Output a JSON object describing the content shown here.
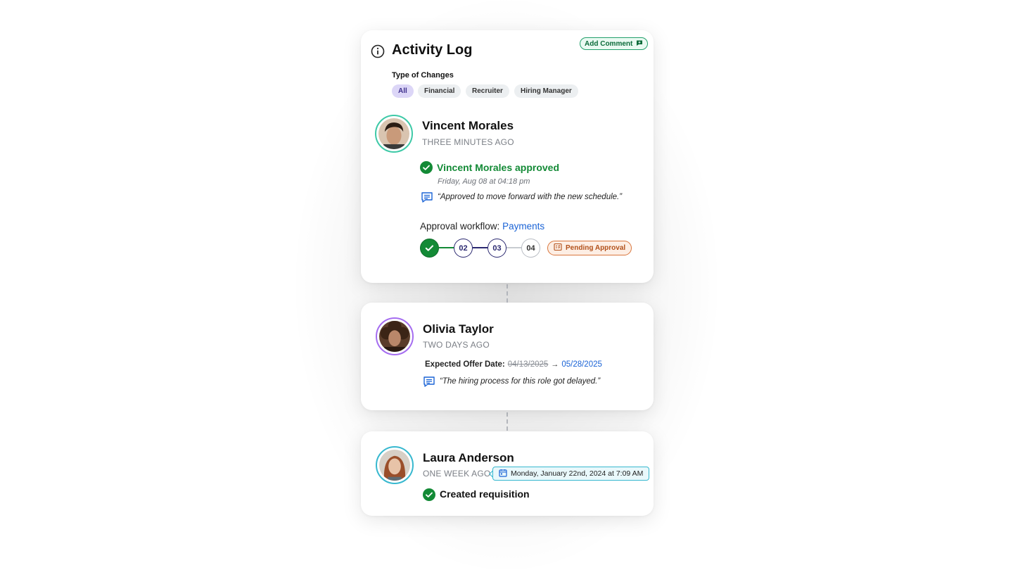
{
  "colors": {
    "accent_green": "#138a36",
    "link_blue": "#1a63d6",
    "pending_orange": "#d9763d",
    "navy": "#2a2870",
    "avatar_ring_1": "#3ec9a7",
    "avatar_ring_2": "#a56df0",
    "avatar_ring_3": "#37b8cf"
  },
  "header": {
    "title": "Activity Log",
    "add_comment_label": "Add Comment",
    "info_icon": "info-icon",
    "comment_icon": "chat-plus-icon"
  },
  "filters": {
    "title": "Type of Changes",
    "chips": [
      {
        "label": "All",
        "active": true
      },
      {
        "label": "Financial",
        "active": false
      },
      {
        "label": "Recruiter",
        "active": false
      },
      {
        "label": "Hiring Manager",
        "active": false
      }
    ]
  },
  "entries": [
    {
      "name": "Vincent Morales",
      "ago": "THREE MINUTES AGO",
      "action": "Vincent Morales approved",
      "timestamp": "Friday, Aug 08 at 04:18 pm",
      "comment": "“Approved to move forward with the new schedule.”",
      "workflow_prefix": "Approval workflow:",
      "workflow_link": "Payments",
      "steps": [
        {
          "label": "",
          "state": "done"
        },
        {
          "label": "02",
          "state": "current"
        },
        {
          "label": "03",
          "state": "current"
        },
        {
          "label": "04",
          "state": "todo"
        }
      ],
      "status_badge": "Pending Approval"
    },
    {
      "name": "Olivia Taylor",
      "ago": "TWO DAYS AGO",
      "field_label": "Expected Offer Date:",
      "old_value": "04/13/2025",
      "new_value": "05/28/2025",
      "comment": "“The hiring process for this role got delayed.”"
    },
    {
      "name": "Laura Anderson",
      "ago": "ONE WEEK AGO",
      "date_tag": "Monday, January 22nd, 2024 at 7:09 AM",
      "action": "Created requisition"
    }
  ]
}
